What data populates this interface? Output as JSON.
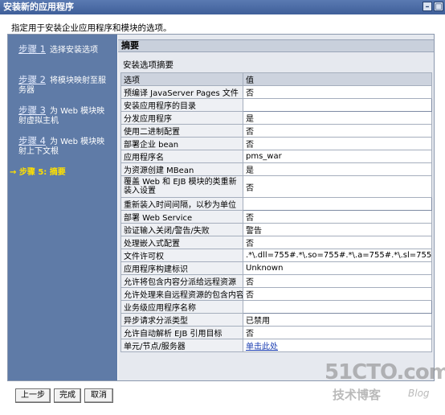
{
  "window": {
    "title": "安装新的应用程序",
    "minimize_glyph": "–",
    "maximize_glyph": "□"
  },
  "intro_text": "指定用于安装企业应用程序和模块的选项。",
  "steps": [
    {
      "num": "步骤 1",
      "text": "选择安装选项"
    },
    {
      "num": "步骤 2",
      "text": "将模块映射至服务器"
    },
    {
      "num": "步骤 3",
      "text": "为 Web 模块映射虚拟主机"
    },
    {
      "num": "步骤 4",
      "text": "为 Web 模块映射上下文根"
    }
  ],
  "current_step": "→ 步骤 5: 摘要",
  "section_title": "摘要",
  "summary_title": "安装选项摘要",
  "table": {
    "headers": [
      "选项",
      "值"
    ],
    "rows": [
      {
        "option": "预编译 JavaServer Pages 文件",
        "value": "否"
      },
      {
        "option": "安装应用程序的目录",
        "value": ""
      },
      {
        "option": "分发应用程序",
        "value": "是"
      },
      {
        "option": "使用二进制配置",
        "value": "否"
      },
      {
        "option": "部署企业 bean",
        "value": "否"
      },
      {
        "option": "应用程序名",
        "value": "pms_war"
      },
      {
        "option": "为资源创建 MBean",
        "value": "是"
      },
      {
        "option": "覆盖 Web 和 EJB 模块的类重新装入设置",
        "value": "否"
      },
      {
        "option": "重新装入时间间隔，以秒为单位",
        "value": ""
      },
      {
        "option": "部署 Web Service",
        "value": "否"
      },
      {
        "option": "验证输入关闭/警告/失败",
        "value": "警告"
      },
      {
        "option": "处理嵌入式配置",
        "value": "否"
      },
      {
        "option": "文件许可权",
        "value": ".*\\.dll=755#.*\\.so=755#.*\\.a=755#.*\\.sl=755"
      },
      {
        "option": "应用程序构建标识",
        "value": "Unknown"
      },
      {
        "option": "允许将包含内容分派给远程资源",
        "value": "否"
      },
      {
        "option": "允许处理来自远程资源的包含内容",
        "value": "否"
      },
      {
        "option": "业务级应用程序名称",
        "value": ""
      },
      {
        "option": "异步请求分派类型",
        "value": "已禁用"
      },
      {
        "option": "允许自动解析 EJB 引用目标",
        "value": "否"
      },
      {
        "option": "单元/节点/服务器",
        "value": "单击此处"
      }
    ]
  },
  "buttons": {
    "previous": "上一步",
    "finish": "完成",
    "cancel": "取消"
  },
  "watermark": {
    "site": "51CTO.com",
    "tagline": "技术博客",
    "blog": "Blog"
  }
}
